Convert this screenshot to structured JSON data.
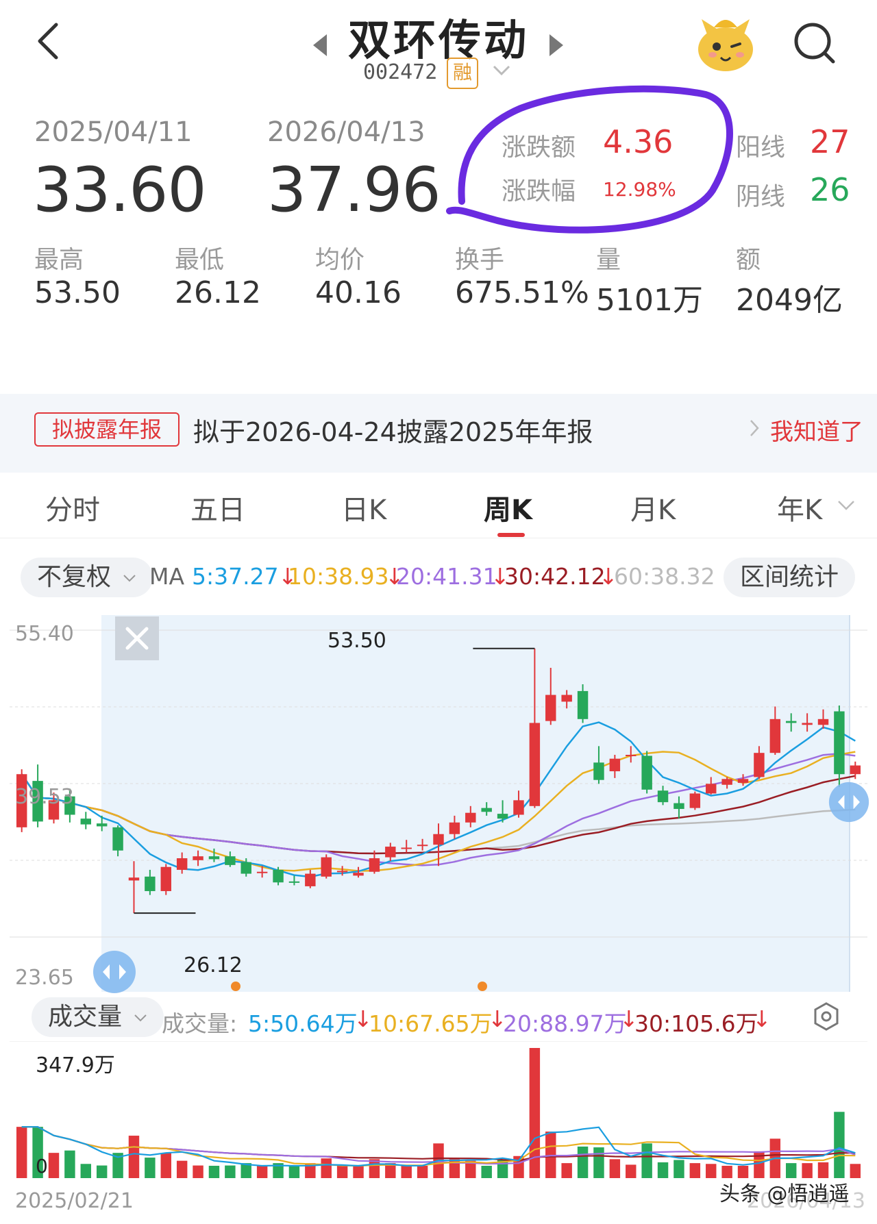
{
  "header": {
    "title": "双环传动",
    "code": "002472",
    "margin_badge": "融"
  },
  "summary": {
    "start_date": "2025/04/11",
    "start_price": "33.60",
    "end_date": "2026/04/13",
    "end_price": "37.96",
    "change_amount_label": "涨跌额",
    "change_amount": "4.36",
    "change_pct_label": "涨跌幅",
    "change_pct": "12.98%",
    "yang_label": "阳线",
    "yang_count": "27",
    "yin_label": "阴线",
    "yin_count": "26",
    "stats": [
      {
        "label": "最高",
        "value": "53.50"
      },
      {
        "label": "最低",
        "value": "26.12"
      },
      {
        "label": "均价",
        "value": "40.16"
      },
      {
        "label": "换手",
        "value": "675.51%"
      },
      {
        "label": "量",
        "value": "5101万"
      },
      {
        "label": "额",
        "value": "2049亿"
      }
    ]
  },
  "notice": {
    "tag": "拟披露年报",
    "text": "拟于2026-04-24披露2025年年报",
    "action": "我知道了"
  },
  "tabs": [
    "分时",
    "五日",
    "日K",
    "周K",
    "月K",
    "年K"
  ],
  "active_tab": "周K",
  "ma_bar": {
    "adjust": "不复权",
    "prefix": "MA",
    "ma5": "5:37.27",
    "ma10": "10:38.93",
    "ma20": "20:41.31",
    "ma30": "30:42.12",
    "ma60": "60:38.32",
    "range_stats": "区间统计"
  },
  "price_chart": {
    "y_top": "55.40",
    "y_mid": "39.53",
    "y_bottom": "23.65",
    "high_marker": "53.50",
    "low_marker": "26.12"
  },
  "volume_bar": {
    "label": "成交量",
    "prefix": "成交量:",
    "v5": "5:50.64万",
    "v10": "10:67.65万",
    "v20": "20:88.97万",
    "v30": "30:105.6万"
  },
  "volume_chart": {
    "y_top": "347.9万",
    "y_zero": "0",
    "start_date": "2025/02/21",
    "end_date": "2026/04/13"
  },
  "watermark": "头条 @悟逍遥",
  "colors": {
    "up": "#e1373b",
    "down": "#27a85a",
    "ma5": "#1a9ee0",
    "ma10": "#e9b021",
    "ma20": "#9d6ee0",
    "ma30": "#9a1d24",
    "ma60": "#bbbbbb",
    "highlight_circle": "#6a2be0"
  },
  "chart_data": {
    "type": "candlestick",
    "ylim": [
      23.65,
      55.4
    ],
    "candles": [
      {
        "o": 35.0,
        "c": 40.5,
        "h": 41.0,
        "l": 34.5
      },
      {
        "o": 39.8,
        "c": 35.6,
        "h": 41.5,
        "l": 35.0
      },
      {
        "o": 35.8,
        "c": 37.8,
        "h": 38.6,
        "l": 35.4
      },
      {
        "o": 38.2,
        "c": 36.3,
        "h": 39.0,
        "l": 35.5
      },
      {
        "o": 35.9,
        "c": 35.3,
        "h": 36.6,
        "l": 34.8
      },
      {
        "o": 35.4,
        "c": 35.1,
        "h": 36.2,
        "l": 34.6
      },
      {
        "o": 35.0,
        "c": 32.6,
        "h": 35.2,
        "l": 32.0
      },
      {
        "o": 29.5,
        "c": 29.8,
        "h": 31.5,
        "l": 26.12
      },
      {
        "o": 29.9,
        "c": 28.4,
        "h": 30.6,
        "l": 28.0
      },
      {
        "o": 28.4,
        "c": 30.9,
        "h": 31.2,
        "l": 28.0
      },
      {
        "o": 30.6,
        "c": 31.8,
        "h": 32.4,
        "l": 30.2
      },
      {
        "o": 31.6,
        "c": 32.0,
        "h": 32.6,
        "l": 31.0
      },
      {
        "o": 32.0,
        "c": 31.7,
        "h": 32.8,
        "l": 31.4
      },
      {
        "o": 32.0,
        "c": 31.1,
        "h": 32.5,
        "l": 30.9
      },
      {
        "o": 31.4,
        "c": 30.2,
        "h": 31.8,
        "l": 29.9
      },
      {
        "o": 30.3,
        "c": 30.4,
        "h": 31.0,
        "l": 29.8
      },
      {
        "o": 30.6,
        "c": 29.3,
        "h": 30.9,
        "l": 29.0
      },
      {
        "o": 29.4,
        "c": 29.3,
        "h": 30.0,
        "l": 29.0
      },
      {
        "o": 28.9,
        "c": 30.2,
        "h": 30.6,
        "l": 28.7
      },
      {
        "o": 29.9,
        "c": 31.9,
        "h": 32.2,
        "l": 29.7
      },
      {
        "o": 30.4,
        "c": 30.5,
        "h": 31.0,
        "l": 30.0
      },
      {
        "o": 30.0,
        "c": 30.3,
        "h": 30.9,
        "l": 29.8
      },
      {
        "o": 30.4,
        "c": 31.8,
        "h": 32.6,
        "l": 30.2
      },
      {
        "o": 31.9,
        "c": 33.0,
        "h": 33.4,
        "l": 31.5
      },
      {
        "o": 32.9,
        "c": 32.9,
        "h": 33.7,
        "l": 32.4
      },
      {
        "o": 33.2,
        "c": 33.2,
        "h": 33.8,
        "l": 32.6
      },
      {
        "o": 33.2,
        "c": 34.3,
        "h": 35.4,
        "l": 31.0
      },
      {
        "o": 34.3,
        "c": 35.5,
        "h": 36.2,
        "l": 33.8
      },
      {
        "o": 35.5,
        "c": 36.5,
        "h": 37.2,
        "l": 35.0
      },
      {
        "o": 37.0,
        "c": 36.6,
        "h": 37.6,
        "l": 36.2
      },
      {
        "o": 36.4,
        "c": 35.9,
        "h": 37.8,
        "l": 35.5
      },
      {
        "o": 36.3,
        "c": 37.8,
        "h": 38.8,
        "l": 36.0
      },
      {
        "o": 37.2,
        "c": 45.8,
        "h": 53.5,
        "l": 37.0
      },
      {
        "o": 46.0,
        "c": 48.7,
        "h": 51.5,
        "l": 45.6
      },
      {
        "o": 48.0,
        "c": 48.7,
        "h": 49.2,
        "l": 47.3
      },
      {
        "o": 49.1,
        "c": 46.2,
        "h": 49.8,
        "l": 45.8
      },
      {
        "o": 41.7,
        "c": 39.9,
        "h": 43.4,
        "l": 39.5
      },
      {
        "o": 40.8,
        "c": 42.1,
        "h": 42.5,
        "l": 40.1
      },
      {
        "o": 42.4,
        "c": 42.5,
        "h": 43.4,
        "l": 41.7
      },
      {
        "o": 42.4,
        "c": 38.9,
        "h": 42.9,
        "l": 38.5
      },
      {
        "o": 38.8,
        "c": 37.6,
        "h": 39.3,
        "l": 37.3
      },
      {
        "o": 37.5,
        "c": 36.9,
        "h": 38.2,
        "l": 35.9
      },
      {
        "o": 37.0,
        "c": 38.5,
        "h": 38.7,
        "l": 36.8
      },
      {
        "o": 38.5,
        "c": 39.5,
        "h": 40.2,
        "l": 38.4
      },
      {
        "o": 39.4,
        "c": 40.0,
        "h": 40.2,
        "l": 39.0
      },
      {
        "o": 39.6,
        "c": 40.0,
        "h": 40.5,
        "l": 39.3
      },
      {
        "o": 40.2,
        "c": 42.7,
        "h": 43.4,
        "l": 40.0
      },
      {
        "o": 42.7,
        "c": 46.2,
        "h": 47.5,
        "l": 42.5
      },
      {
        "o": 46.0,
        "c": 45.8,
        "h": 46.8,
        "l": 44.9
      },
      {
        "o": 45.6,
        "c": 45.8,
        "h": 46.8,
        "l": 44.9
      },
      {
        "o": 45.6,
        "c": 46.2,
        "h": 47.2,
        "l": 45.2
      },
      {
        "o": 47.0,
        "c": 40.5,
        "h": 47.6,
        "l": 39.2
      },
      {
        "o": 40.5,
        "c": 41.4,
        "h": 41.8,
        "l": 40.0
      }
    ]
  }
}
